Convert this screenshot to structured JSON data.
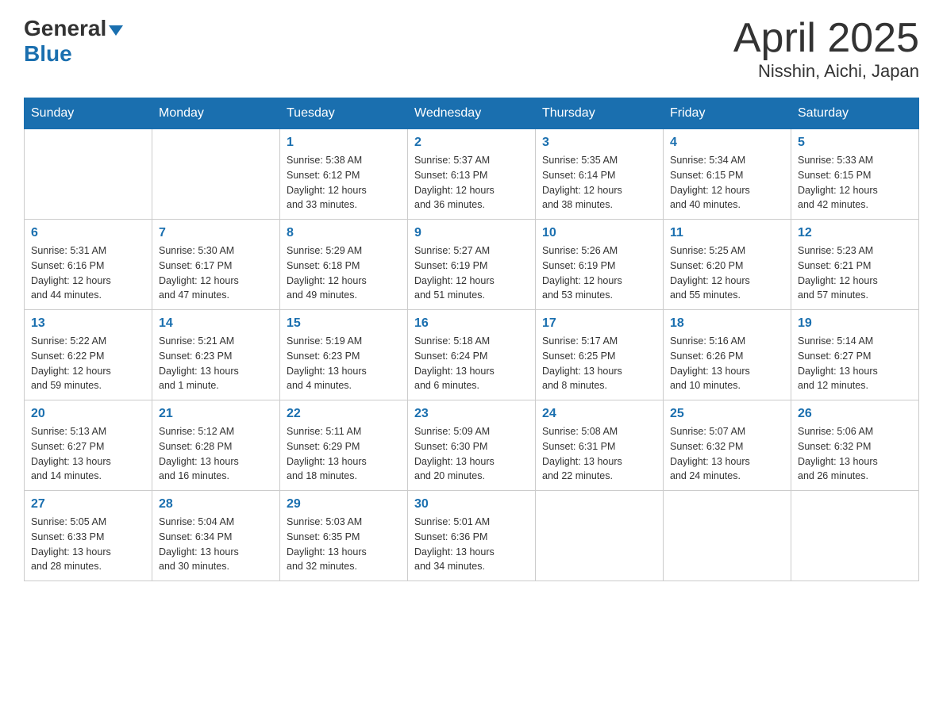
{
  "header": {
    "logo": {
      "general": "General",
      "blue": "Blue"
    },
    "title": "April 2025",
    "subtitle": "Nisshin, Aichi, Japan"
  },
  "days_of_week": [
    "Sunday",
    "Monday",
    "Tuesday",
    "Wednesday",
    "Thursday",
    "Friday",
    "Saturday"
  ],
  "weeks": [
    [
      {
        "day": "",
        "info": ""
      },
      {
        "day": "",
        "info": ""
      },
      {
        "day": "1",
        "info": "Sunrise: 5:38 AM\nSunset: 6:12 PM\nDaylight: 12 hours\nand 33 minutes."
      },
      {
        "day": "2",
        "info": "Sunrise: 5:37 AM\nSunset: 6:13 PM\nDaylight: 12 hours\nand 36 minutes."
      },
      {
        "day": "3",
        "info": "Sunrise: 5:35 AM\nSunset: 6:14 PM\nDaylight: 12 hours\nand 38 minutes."
      },
      {
        "day": "4",
        "info": "Sunrise: 5:34 AM\nSunset: 6:15 PM\nDaylight: 12 hours\nand 40 minutes."
      },
      {
        "day": "5",
        "info": "Sunrise: 5:33 AM\nSunset: 6:15 PM\nDaylight: 12 hours\nand 42 minutes."
      }
    ],
    [
      {
        "day": "6",
        "info": "Sunrise: 5:31 AM\nSunset: 6:16 PM\nDaylight: 12 hours\nand 44 minutes."
      },
      {
        "day": "7",
        "info": "Sunrise: 5:30 AM\nSunset: 6:17 PM\nDaylight: 12 hours\nand 47 minutes."
      },
      {
        "day": "8",
        "info": "Sunrise: 5:29 AM\nSunset: 6:18 PM\nDaylight: 12 hours\nand 49 minutes."
      },
      {
        "day": "9",
        "info": "Sunrise: 5:27 AM\nSunset: 6:19 PM\nDaylight: 12 hours\nand 51 minutes."
      },
      {
        "day": "10",
        "info": "Sunrise: 5:26 AM\nSunset: 6:19 PM\nDaylight: 12 hours\nand 53 minutes."
      },
      {
        "day": "11",
        "info": "Sunrise: 5:25 AM\nSunset: 6:20 PM\nDaylight: 12 hours\nand 55 minutes."
      },
      {
        "day": "12",
        "info": "Sunrise: 5:23 AM\nSunset: 6:21 PM\nDaylight: 12 hours\nand 57 minutes."
      }
    ],
    [
      {
        "day": "13",
        "info": "Sunrise: 5:22 AM\nSunset: 6:22 PM\nDaylight: 12 hours\nand 59 minutes."
      },
      {
        "day": "14",
        "info": "Sunrise: 5:21 AM\nSunset: 6:23 PM\nDaylight: 13 hours\nand 1 minute."
      },
      {
        "day": "15",
        "info": "Sunrise: 5:19 AM\nSunset: 6:23 PM\nDaylight: 13 hours\nand 4 minutes."
      },
      {
        "day": "16",
        "info": "Sunrise: 5:18 AM\nSunset: 6:24 PM\nDaylight: 13 hours\nand 6 minutes."
      },
      {
        "day": "17",
        "info": "Sunrise: 5:17 AM\nSunset: 6:25 PM\nDaylight: 13 hours\nand 8 minutes."
      },
      {
        "day": "18",
        "info": "Sunrise: 5:16 AM\nSunset: 6:26 PM\nDaylight: 13 hours\nand 10 minutes."
      },
      {
        "day": "19",
        "info": "Sunrise: 5:14 AM\nSunset: 6:27 PM\nDaylight: 13 hours\nand 12 minutes."
      }
    ],
    [
      {
        "day": "20",
        "info": "Sunrise: 5:13 AM\nSunset: 6:27 PM\nDaylight: 13 hours\nand 14 minutes."
      },
      {
        "day": "21",
        "info": "Sunrise: 5:12 AM\nSunset: 6:28 PM\nDaylight: 13 hours\nand 16 minutes."
      },
      {
        "day": "22",
        "info": "Sunrise: 5:11 AM\nSunset: 6:29 PM\nDaylight: 13 hours\nand 18 minutes."
      },
      {
        "day": "23",
        "info": "Sunrise: 5:09 AM\nSunset: 6:30 PM\nDaylight: 13 hours\nand 20 minutes."
      },
      {
        "day": "24",
        "info": "Sunrise: 5:08 AM\nSunset: 6:31 PM\nDaylight: 13 hours\nand 22 minutes."
      },
      {
        "day": "25",
        "info": "Sunrise: 5:07 AM\nSunset: 6:32 PM\nDaylight: 13 hours\nand 24 minutes."
      },
      {
        "day": "26",
        "info": "Sunrise: 5:06 AM\nSunset: 6:32 PM\nDaylight: 13 hours\nand 26 minutes."
      }
    ],
    [
      {
        "day": "27",
        "info": "Sunrise: 5:05 AM\nSunset: 6:33 PM\nDaylight: 13 hours\nand 28 minutes."
      },
      {
        "day": "28",
        "info": "Sunrise: 5:04 AM\nSunset: 6:34 PM\nDaylight: 13 hours\nand 30 minutes."
      },
      {
        "day": "29",
        "info": "Sunrise: 5:03 AM\nSunset: 6:35 PM\nDaylight: 13 hours\nand 32 minutes."
      },
      {
        "day": "30",
        "info": "Sunrise: 5:01 AM\nSunset: 6:36 PM\nDaylight: 13 hours\nand 34 minutes."
      },
      {
        "day": "",
        "info": ""
      },
      {
        "day": "",
        "info": ""
      },
      {
        "day": "",
        "info": ""
      }
    ]
  ]
}
